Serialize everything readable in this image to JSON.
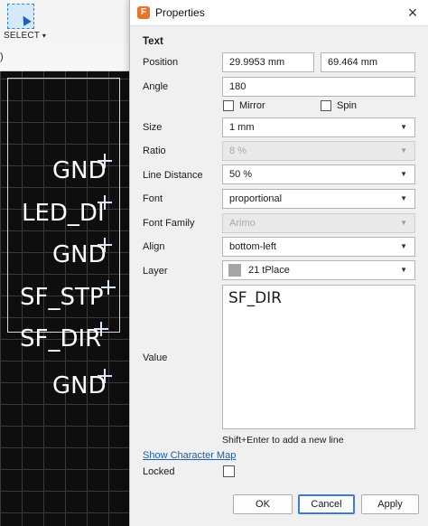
{
  "toolbar": {
    "select_label": "SELECT",
    "select_caret": "▾"
  },
  "subbar": {
    "text": ")"
  },
  "canvas": {
    "labels": [
      "GND",
      "LED_DI",
      "GND",
      "SF_STP",
      "SF_DIR",
      "GND"
    ]
  },
  "dialog": {
    "title": "Properties",
    "app_icon": "F",
    "close": "×",
    "section": "Text",
    "position_label": "Position",
    "position_x": "29.9953 mm",
    "position_y": "69.464 mm",
    "angle_label": "Angle",
    "angle": "180",
    "mirror_label": "Mirror",
    "spin_label": "Spin",
    "size_label": "Size",
    "size": "1 mm",
    "ratio_label": "Ratio",
    "ratio": "8 %",
    "line_distance_label": "Line Distance",
    "line_distance": "50 %",
    "font_label": "Font",
    "font": "proportional",
    "font_family_label": "Font Family",
    "font_family": "Arimo",
    "align_label": "Align",
    "align": "bottom-left",
    "layer_label": "Layer",
    "layer": "21 tPlace",
    "layer_color": "#a6a6a6",
    "value_label": "Value",
    "value": "SF_DIR",
    "hint": "Shift+Enter to add a new line",
    "charmap_link": "Show Character Map",
    "locked_label": "Locked",
    "ok": "OK",
    "cancel": "Cancel",
    "apply": "Apply",
    "dropdown_arrow": "▼",
    "mirror_checked": false,
    "spin_checked": false,
    "locked_checked": false
  },
  "colors": {
    "accent": "#3a7bd5",
    "link": "#1a5fb4",
    "canvas_bg": "#0e0e0e",
    "app_icon": "#e8742c"
  }
}
